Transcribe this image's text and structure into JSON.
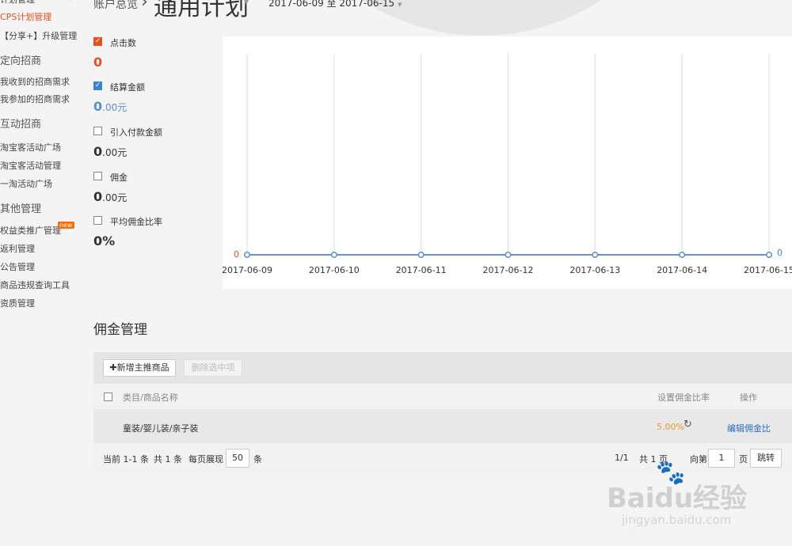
{
  "sidebar": {
    "items": [
      {
        "label": "计划管理",
        "type": "item"
      },
      {
        "label": "CPS计划管理",
        "type": "item",
        "active": true
      },
      {
        "label": "【分享+】升级管理",
        "type": "item"
      },
      {
        "label": "定向招商",
        "type": "head"
      },
      {
        "label": "我收到的招商需求",
        "type": "item"
      },
      {
        "label": "我参加的招商需求",
        "type": "item"
      },
      {
        "label": "互动招商",
        "type": "head"
      },
      {
        "label": "淘宝客活动广场",
        "type": "item"
      },
      {
        "label": "淘宝客活动管理",
        "type": "item"
      },
      {
        "label": "一淘活动广场",
        "type": "item"
      },
      {
        "label": "其他管理",
        "type": "head"
      },
      {
        "label": "权益类推广管理",
        "type": "item",
        "badge": "new"
      },
      {
        "label": "返利管理",
        "type": "item"
      },
      {
        "label": "公告管理",
        "type": "item"
      },
      {
        "label": "商品违规查询工具",
        "type": "item"
      },
      {
        "label": "资质管理",
        "type": "item"
      }
    ]
  },
  "header": {
    "breadcrumb": "账户总览",
    "separator": "›",
    "title": "通用计划",
    "date_range": "2017-06-09 至 2017-06-15"
  },
  "metrics": [
    {
      "label": "点击数",
      "value": "0",
      "unit": "",
      "checked": true,
      "color": "#e4501e"
    },
    {
      "label": "结算金额",
      "value": "0",
      "unit": ".00元",
      "checked": true,
      "color": "#3d82d4"
    },
    {
      "label": "引入付款金额",
      "value": "0",
      "unit": ".00元",
      "checked": false
    },
    {
      "label": "佣金",
      "value": "0",
      "unit": ".00元",
      "checked": false
    },
    {
      "label": "平均佣金比率",
      "value": "0%",
      "unit": "",
      "checked": false
    }
  ],
  "chart_data": {
    "type": "line",
    "x": [
      "2017-06-09",
      "2017-06-10",
      "2017-06-11",
      "2017-06-12",
      "2017-06-13",
      "2017-06-14",
      "2017-06-15"
    ],
    "series": [
      {
        "name": "点击数",
        "values": [
          0,
          0,
          0,
          0,
          0,
          0,
          0
        ],
        "color": "#e4501e"
      },
      {
        "name": "结算金额",
        "values": [
          0,
          0,
          0,
          0,
          0,
          0,
          0
        ],
        "color": "#3d82d4"
      }
    ],
    "left_axis_label": "0",
    "right_axis_label": "0",
    "grid": "vertical",
    "line_color": "#5b8fc9"
  },
  "commission": {
    "title": "佣金管理",
    "add_button": "✚新增主推商品",
    "delete_button": "删除选中项",
    "columns": {
      "name": "类目/商品名称",
      "rate": "设置佣金比率",
      "op": "操作"
    },
    "rows": [
      {
        "name": "童装/婴儿装/亲子装",
        "rate": "5.00%",
        "op": "编辑佣金比"
      }
    ]
  },
  "pager": {
    "current": "当前 1-1 条",
    "total": "共 1 条",
    "per_page_label": "每页展现",
    "per_page": "50",
    "per_page_unit": "条",
    "page_info": "1/1",
    "pages_total": "共 1 页",
    "goto_label": "向第",
    "goto_page": "1",
    "goto_unit": "页",
    "jump_button": "跳转"
  },
  "watermark": {
    "logo": "Baidu经验",
    "url": "jingyan.baidu.com"
  }
}
